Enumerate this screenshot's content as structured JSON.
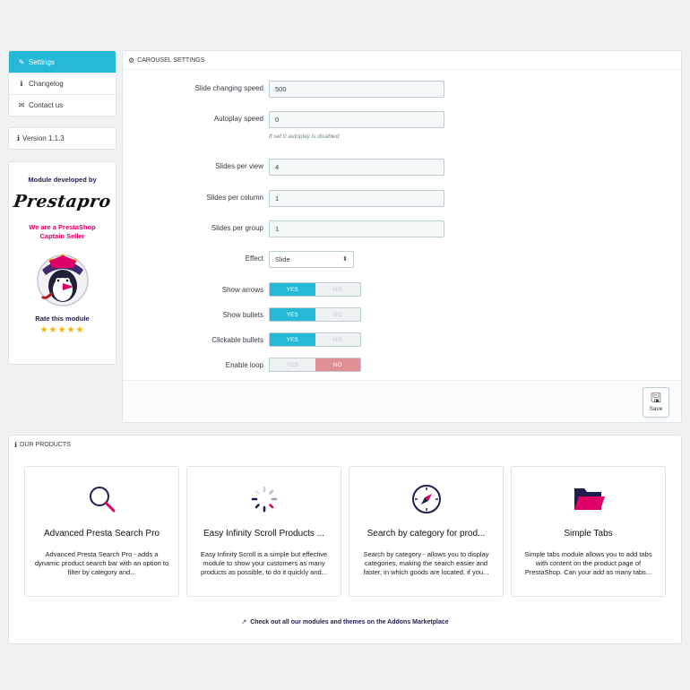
{
  "sidebar": {
    "items": [
      {
        "icon": "wrench-icon",
        "glyph": "✎",
        "label": "Settings",
        "active": true
      },
      {
        "icon": "info-icon",
        "glyph": "ℹ",
        "label": "Changelog",
        "active": false
      },
      {
        "icon": "envelope-icon",
        "glyph": "✉",
        "label": "Contact us",
        "active": false
      }
    ],
    "version_glyph": "ℹ",
    "version": "Version 1.1.3"
  },
  "developer": {
    "title": "Module developed by",
    "brand": "Prestapro",
    "captain_line1": "We are a PrestaShop",
    "captain_line2": "Captain Seller",
    "rate": "Rate this module",
    "stars": "★★★★★"
  },
  "carousel": {
    "heading_glyph": "⚙",
    "heading": "CAROUSEL SETTINGS",
    "fields": {
      "speed": {
        "label": "Slide changing speed",
        "value": "500"
      },
      "autoplay": {
        "label": "Autoplay speed",
        "value": "0",
        "help": "If set 0 autoplay is disabled"
      },
      "per_view": {
        "label": "Slides per view",
        "value": "4"
      },
      "per_column": {
        "label": "Slides per column",
        "value": "1"
      },
      "per_group": {
        "label": "Slides per group",
        "value": "1"
      },
      "effect": {
        "label": "Effect",
        "value": "Slide",
        "caret": "⬍"
      }
    },
    "switches": {
      "arrows": {
        "label": "Show arrows",
        "yes": "YES",
        "no": "NO",
        "on": "yes"
      },
      "bullets": {
        "label": "Show bullets",
        "yes": "YES",
        "no": "NO",
        "on": "yes"
      },
      "clickable": {
        "label": "Clickable bullets",
        "yes": "YES",
        "no": "NO",
        "on": "yes"
      },
      "loop": {
        "label": "Enable loop",
        "yes": "YES",
        "no": "NO",
        "on": "no"
      }
    },
    "save_glyph": "🖫",
    "save_label": "Save"
  },
  "products": {
    "heading_glyph": "ℹ",
    "heading": "OUR PRODUCTS",
    "cards": [
      {
        "icon": "magnifier-icon",
        "title": "Advanced Presta Search Pro",
        "desc": "Advanced Presta Search Pro - adds a dynamic product search bar with an option to filter by category and..."
      },
      {
        "icon": "spinner-icon",
        "title": "Easy Infinity Scroll Products ...",
        "desc": "Easy Infinity Scroll is a simple but effective module to show your customers as many products as possible, to do it quickly and..."
      },
      {
        "icon": "compass-icon",
        "title": "Search by category for prod...",
        "desc": "Search by category - allows you to display categories, making the search easier and faster, in which goods are located, if you..."
      },
      {
        "icon": "folder-icon",
        "title": "Simple Tabs",
        "desc": "Simple tabs module allows you to add tabs with content on the product page of PrestaShop. Can your add as many tabs..."
      }
    ],
    "link_glyph": "↗",
    "link": "Check out all our modules and themes on the Addons Marketplace"
  },
  "colors": {
    "accent": "#25b9d7",
    "danger": "#e08f95",
    "brand_pink": "#df0067",
    "star": "#f7b500"
  }
}
